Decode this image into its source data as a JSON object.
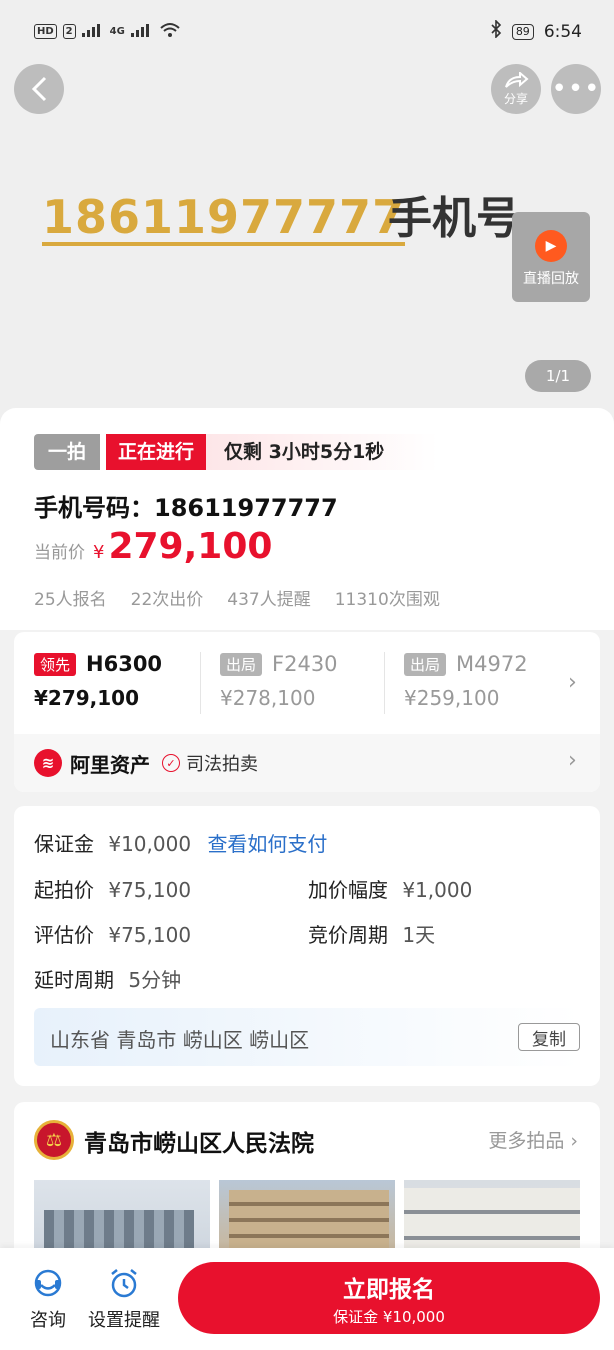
{
  "status_bar": {
    "network": "HD",
    "sim": "2",
    "signal_label": "4G",
    "battery": "89",
    "time": "6:54"
  },
  "hero": {
    "share_label": "分享",
    "image_number": "18611977777",
    "image_label": "手机号",
    "live_label": "直播回放",
    "counter": "1/1"
  },
  "auction": {
    "round": "一拍",
    "status": "正在进行",
    "remaining": "仅剩 3小时5分1秒",
    "title": "手机号码：18611977777",
    "price_label": "当前价",
    "price_symbol": "¥",
    "current_price": "279,100",
    "stats": [
      "25人报名",
      "22次出价",
      "437人提醒",
      "11310次围观"
    ]
  },
  "bids": [
    {
      "badge": "领先",
      "code": "H6300",
      "price": "¥279,100"
    },
    {
      "badge": "出局",
      "code": "F2430",
      "price": "¥278,100"
    },
    {
      "badge": "出局",
      "code": "M4972",
      "price": "¥259,100"
    }
  ],
  "platform": {
    "name": "阿里资产",
    "tag": "司法拍卖"
  },
  "details": {
    "deposit_label": "保证金",
    "deposit_value": "¥10,000",
    "pay_link": "查看如何支付",
    "start_label": "起拍价",
    "start_value": "¥75,100",
    "increment_label": "加价幅度",
    "increment_value": "¥1,000",
    "appraisal_label": "评估价",
    "appraisal_value": "¥75,100",
    "cycle_label": "竞价周期",
    "cycle_value": "1天",
    "delay_label": "延时周期",
    "delay_value": "5分钟",
    "address": "山东省 青岛市 崂山区 崂山区",
    "copy_label": "复制"
  },
  "court": {
    "name": "青岛市崂山区人民法院",
    "more": "更多拍品"
  },
  "bottom_bar": {
    "consult": "咨询",
    "reminder": "设置提醒",
    "cta_main": "立即报名",
    "cta_sub": "保证金 ¥10,000"
  },
  "colors": {
    "accent": "#e8112d",
    "link": "#2a6fc9",
    "gold": "#d9a93e"
  }
}
